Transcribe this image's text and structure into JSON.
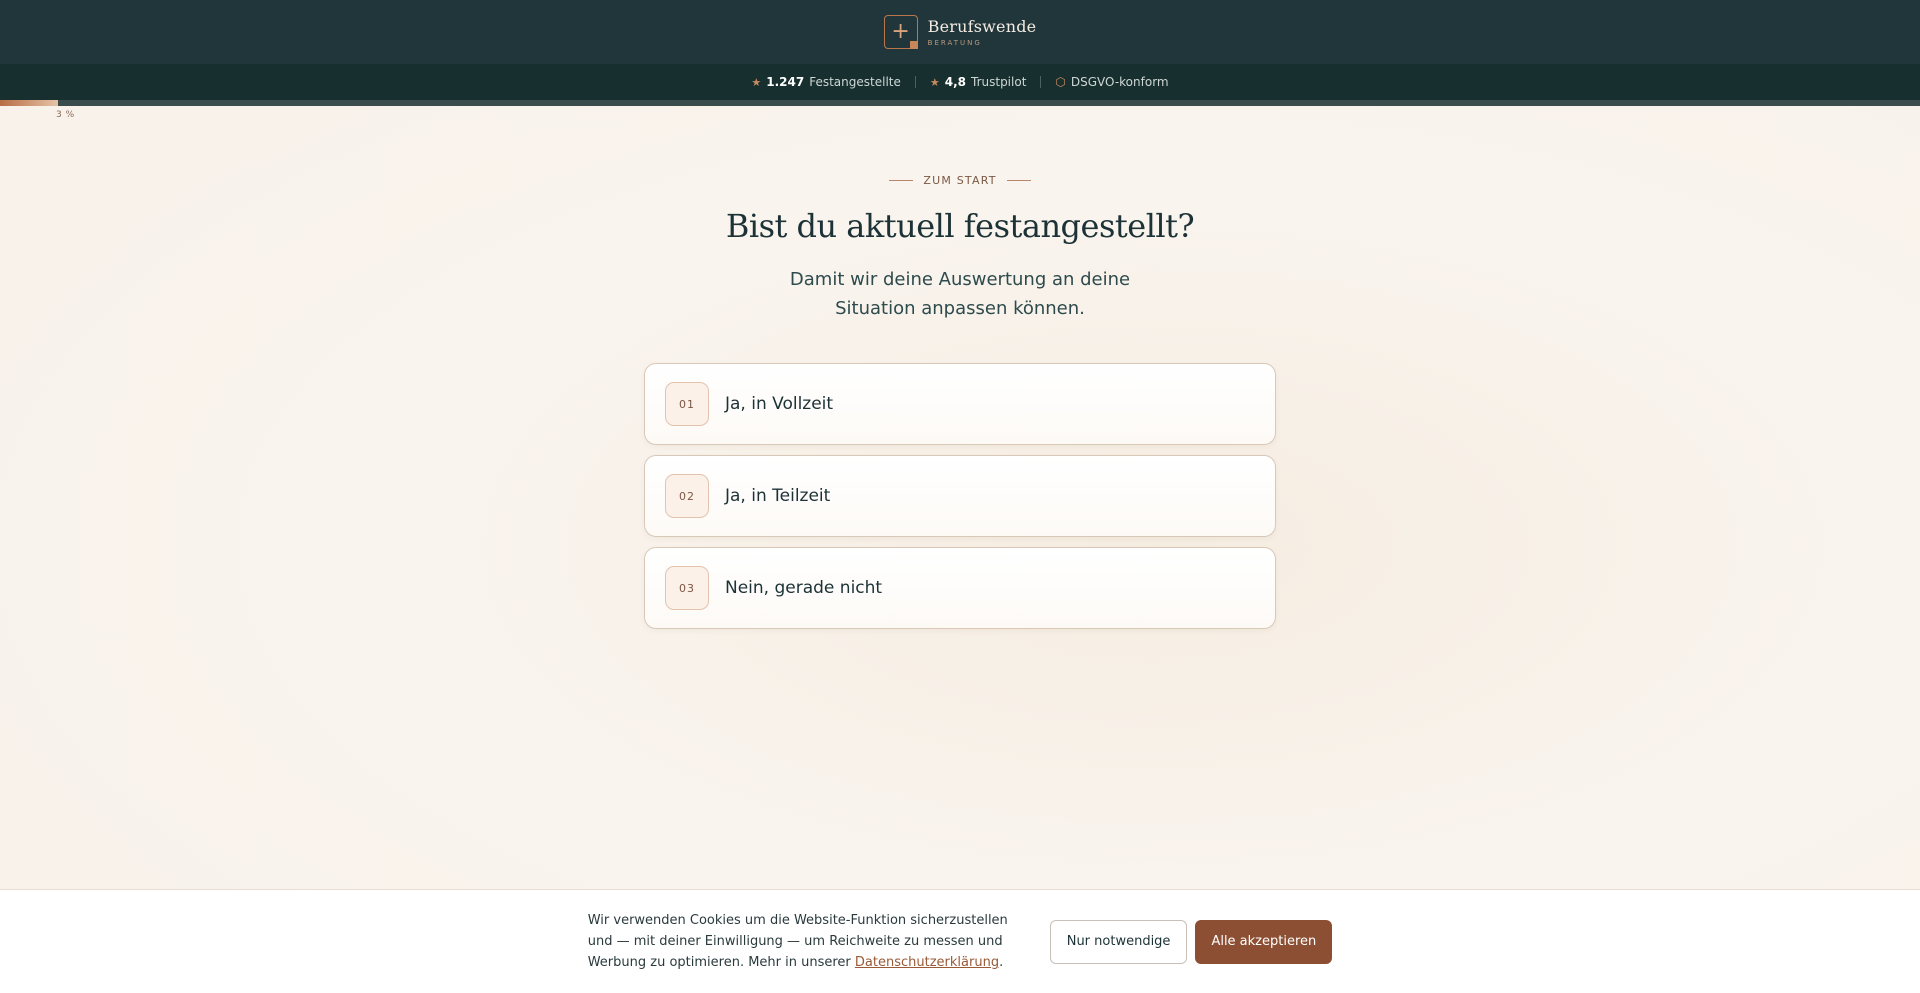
{
  "header": {
    "logo_glyph": "+",
    "brand_name": "Berufswende",
    "brand_sub": "BERATUNG"
  },
  "trustbar": {
    "items": [
      {
        "icon": "star-icon",
        "value": "1.247",
        "label": "Festangestellte"
      },
      {
        "icon": "star-icon",
        "value": "4,8",
        "label": "Trustpilot"
      },
      {
        "icon": "shield-icon",
        "value": "",
        "label": "DSGVO-konform"
      }
    ]
  },
  "progress": {
    "percent": 3,
    "label": "3 %"
  },
  "question": {
    "eyebrow": "ZUM START",
    "title": "Bist du aktuell festangestellt?",
    "subtitle": "Damit wir deine Auswertung an deine Situation anpassen können."
  },
  "options": [
    {
      "num": "01",
      "label": "Ja, in Vollzeit"
    },
    {
      "num": "02",
      "label": "Ja, in Teilzeit"
    },
    {
      "num": "03",
      "label": "Nein, gerade nicht"
    }
  ],
  "cookie": {
    "text": "Wir verwenden Cookies um die Website-Funktion sicherzustellen und — mit deiner Einwilligung — um Reichweite zu messen und Werbung zu optimieren. Mehr in unserer ",
    "link_label": "Datenschutzerklärung",
    "text_end": ".",
    "btn_necessary": "Nur notwendige",
    "btn_accept": "Alle akzeptieren"
  },
  "colors": {
    "header_bg": "#21363b",
    "trustbar_bg": "#17302f",
    "accent": "#8c4f33",
    "page_bg": "#f9f4ee"
  }
}
